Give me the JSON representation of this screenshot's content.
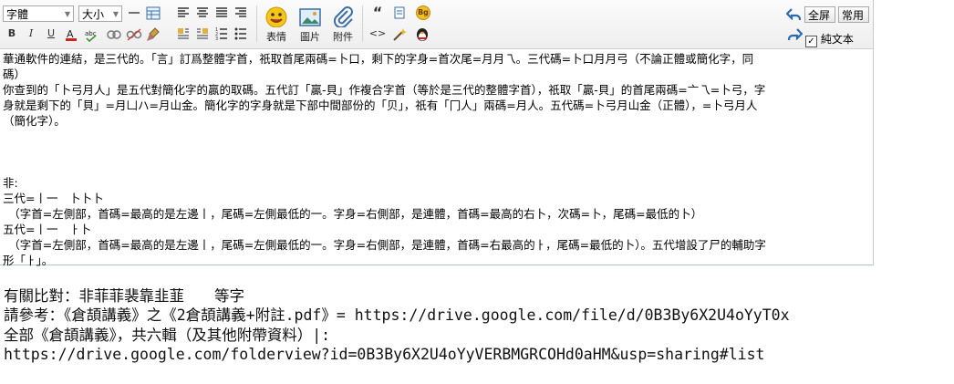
{
  "toolbar": {
    "font_select": "字體",
    "size_select": "大小",
    "emoticon_label": "表情",
    "image_label": "圖片",
    "attach_label": "附件",
    "fullscreen_label": "全屏",
    "common_label": "常用",
    "plaintext_label": "純文本",
    "plaintext_checked": true,
    "bold": "B",
    "italic": "I",
    "underline": "U",
    "quote": "“",
    "code": "<>",
    "bg_badge": "Bg"
  },
  "content": {
    "lines": [
      "華通軟件的連結，是三代的。「言」訂爲整體字首，祇取首尾兩碼=卜口，剩下的字身=首次尾=月月乁。三代碼=卜口月月弓（不論正體或簡化字，同",
      "碼）",
      "你查到的「卜弓月人」是五代對簡化字的贏的取碼。五代訂「贏-貝」作複合字首（等於是三代的整體字首），祇取「贏-貝」的首尾兩碼=亠乁=卜弓，字",
      "身就是剩下的「貝」=月凵ハ=月山金。簡化字的字身就是下部中間部份的「贝」，祇有「冂人」兩碼=月人。五代碼=卜弓月山金（正體），=卜弓月人",
      "（簡化字）。",
      "",
      "",
      "",
      "非:",
      "三代=丨一　卜卜卜",
      "　（字首=左側部，首碼=最高的是左邊丨，尾碼=左側最低的一。字身=右側部，是連體，首碼=最高的右卜，次碼=卜，尾碼=最低的卜）",
      "五代=丨一　ㅏ卜",
      "　（字首=左側部，首碼=最高的是左邊丨，尾碼=左側最低的一。字身=右側部，是連體，首碼=右最高的ㅏ，尾碼=最低的卜）。五代增設了尸的輔助字",
      "形「ㅏ」。"
    ]
  },
  "bottom": {
    "line1": "有關比對：非菲菲裴靠韭韮　　等字",
    "line2": "請參考：《倉頡講義》之《2倉頡講義+附註.pdf》= https://drive.google.com/file/d/0B3By6X2U4oYyT0x",
    "line3": "全部《倉頡講義》，共六輯（及其他附帶資料）|:",
    "line4": "https://drive.google.com/folderview?id=0B3By6X2U4oYyVERBMGRCOHd0aHM&usp=sharing#list"
  }
}
